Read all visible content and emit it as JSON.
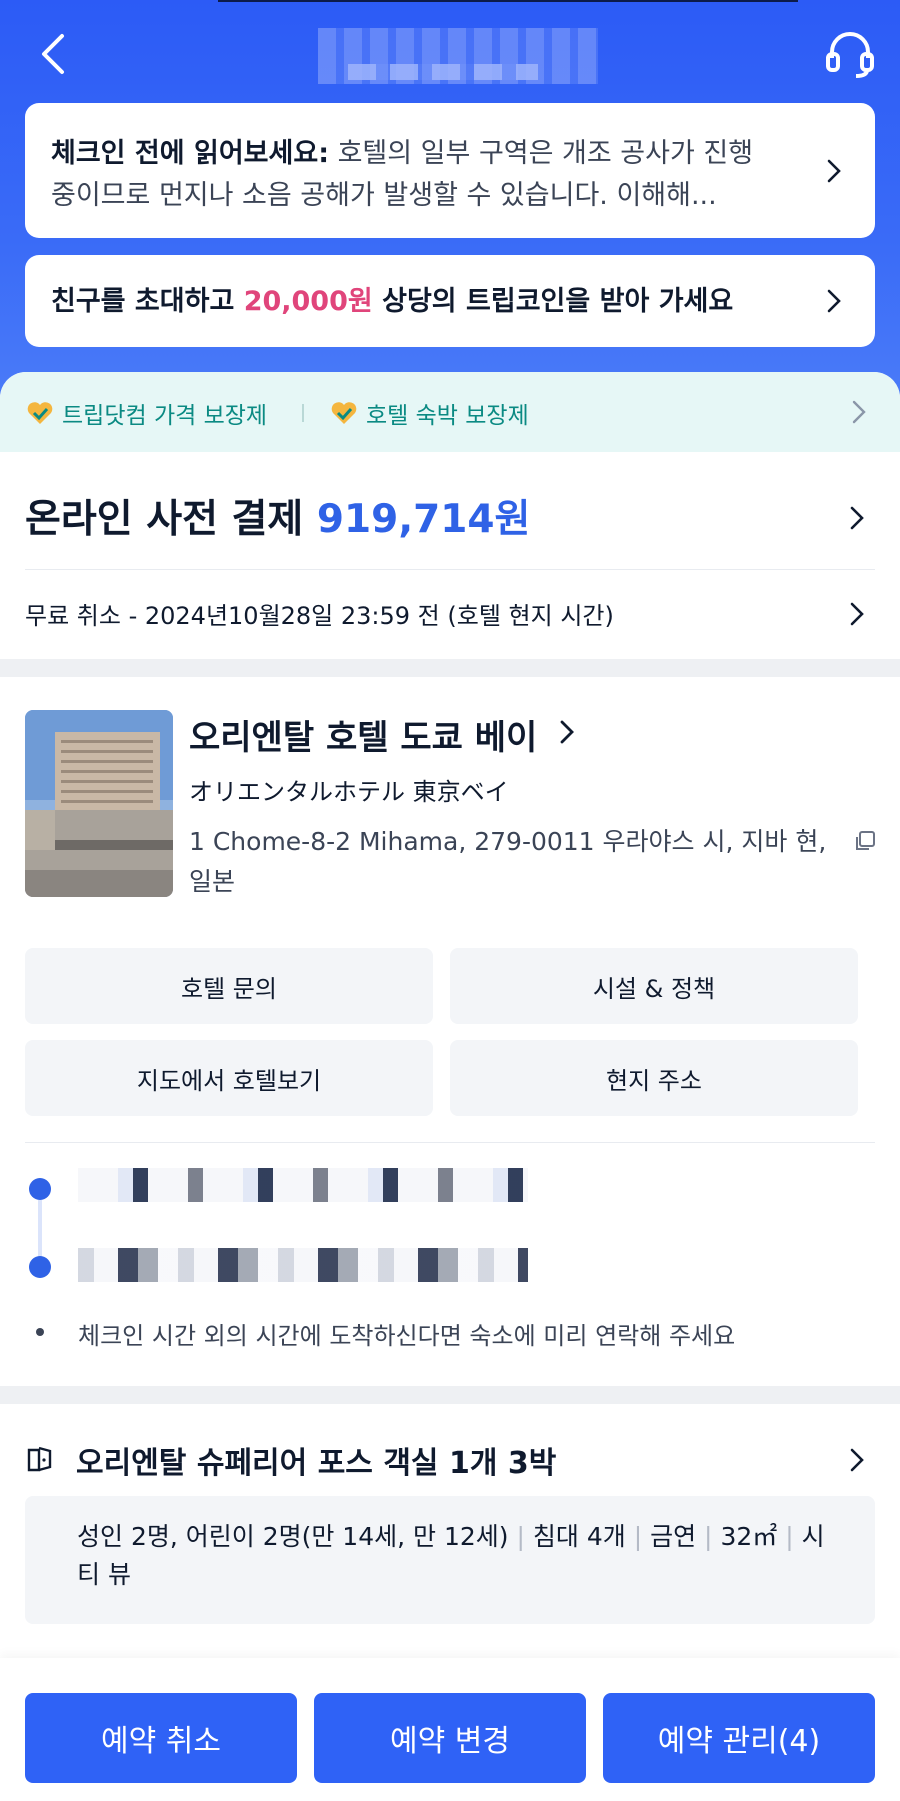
{
  "header": {
    "back_icon": "chevron-left-icon",
    "support_icon": "headset-icon"
  },
  "notices": [
    {
      "title": "체크인 전에 읽어보세요:",
      "text": " 호텔의 일부 구역은 개조 공사가 진행 중이므로 먼지나 소음 공해가 발생할 수 있습니다. 이해해..."
    },
    {
      "prefix": "친구를 초대하고 ",
      "highlight": "20,000원",
      "suffix": " 상당의 트립코인을 받아 가세요"
    }
  ],
  "guarantees": [
    "트립닷컴 가격 보장제",
    "호텔 숙박 보장제"
  ],
  "payment": {
    "label": "온라인 사전 결제 ",
    "amount": "919,714원"
  },
  "cancellation": "무료 취소 - 2024년10월28일 23:59 전 (호텔 현지 시간)",
  "hotel": {
    "name": "오리엔탈 호텔 도쿄 베이",
    "name_jp": "オリエンタルホテル 東京ベイ",
    "address": "1 Chome-8-2 Mihama, 279-0011 우라야스 시, 지바 현, 일본"
  },
  "actions": [
    "호텔 문의",
    "시설 & 정책",
    "지도에서 호텔보기",
    "현지 주소"
  ],
  "checkin_note": "체크인 시간 외의 시간에 도착하신다면 숙소에 미리 연락해 주세요",
  "room": {
    "title": "오리엔탈 슈페리어 포스  객실 1개 3박",
    "guests": "성인 2명, 어린이 2명(만 14세, 만 12세)",
    "beds": "침대 4개",
    "smoking": "금연",
    "size": "32㎡",
    "view": "시티 뷰"
  },
  "bottom_buttons": [
    "예약 취소",
    "예약 변경",
    "예약 관리(4)"
  ],
  "colors": {
    "accent": "#2f62f6",
    "header_bg": "#2c5bf6",
    "price": "#2f62e6",
    "highlight": "#e0457b",
    "guarantee_text": "#0b8a83"
  }
}
